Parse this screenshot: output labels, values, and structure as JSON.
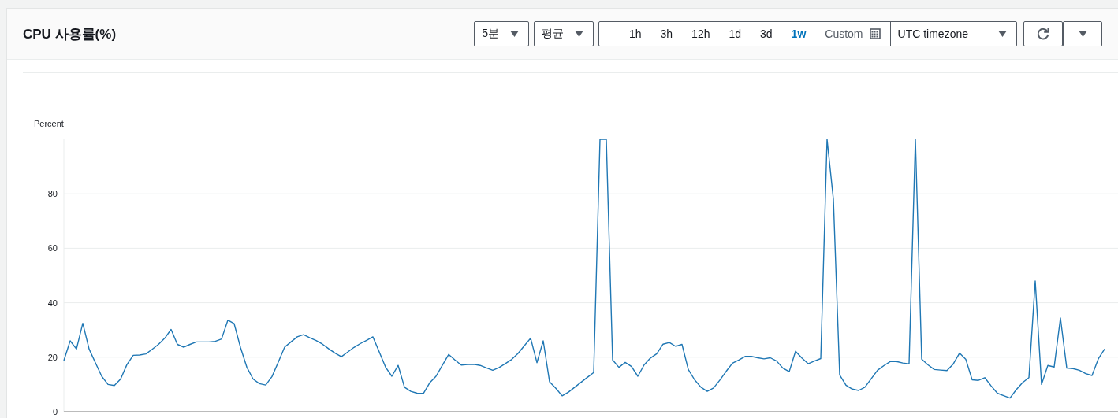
{
  "widget": {
    "title": "CPU 사용률(%)",
    "period": "5분",
    "statistic": "평균",
    "ranges": [
      {
        "label": "1h",
        "kind": "preset",
        "selected": false
      },
      {
        "label": "3h",
        "kind": "preset",
        "selected": false
      },
      {
        "label": "12h",
        "kind": "preset",
        "selected": false
      },
      {
        "label": "1d",
        "kind": "preset",
        "selected": false
      },
      {
        "label": "3d",
        "kind": "preset",
        "selected": false
      },
      {
        "label": "1w",
        "kind": "preset",
        "selected": true
      },
      {
        "label": "Custom",
        "kind": "custom",
        "selected": false
      }
    ],
    "timezone": "UTC timezone"
  },
  "chart_data": {
    "type": "line",
    "annotations": [
      {
        "text": "Percent"
      }
    ],
    "grid": true,
    "ylim": [
      0,
      100
    ],
    "yticks": [
      0,
      20,
      40,
      60,
      80
    ],
    "categories": [
      null,
      null,
      null,
      null,
      null,
      null,
      null,
      null,
      null,
      null,
      null,
      null,
      null,
      null,
      null,
      null,
      null,
      null,
      null,
      null,
      null,
      null,
      null,
      null,
      null,
      null,
      null,
      null,
      null,
      null,
      null,
      null,
      null,
      null,
      null,
      null,
      null,
      null,
      null,
      null,
      null,
      null,
      null,
      null,
      null,
      null,
      null,
      null,
      null,
      null,
      null,
      null,
      null,
      null,
      null,
      null,
      null,
      null,
      null,
      null,
      null,
      null,
      null,
      null,
      null,
      null,
      null,
      null,
      null,
      null,
      null,
      null,
      null,
      null,
      null,
      null,
      null,
      null,
      null,
      null,
      null,
      null,
      null,
      null,
      null,
      null,
      null,
      null,
      null,
      null,
      null,
      null,
      null,
      null,
      null,
      null,
      null,
      null,
      null,
      null,
      null,
      null,
      null,
      null,
      null,
      null,
      null,
      null,
      null,
      null,
      null,
      null,
      null,
      null,
      null,
      null,
      null,
      null,
      null,
      null,
      null,
      null,
      null,
      null,
      null,
      null,
      null,
      null,
      null,
      null,
      null,
      null,
      null,
      null,
      null,
      null,
      null,
      null,
      null,
      null,
      null,
      null,
      null,
      null,
      null,
      null,
      null,
      null,
      null,
      null,
      null,
      null,
      null,
      null,
      null,
      null,
      null,
      null,
      null,
      null,
      null,
      null,
      null,
      null,
      null,
      null
    ],
    "series": [
      {
        "color": "#1f77b4",
        "values": [
          18.8,
          26,
          23,
          32.5,
          23,
          18,
          13,
          10,
          9.6,
          12,
          17.3,
          20.7,
          20.8,
          21.2,
          22.9,
          24.7,
          27,
          30.2,
          24.7,
          23.7,
          24.7,
          25.6,
          25.6,
          25.6,
          25.8,
          26.7,
          33.6,
          32.3,
          23.6,
          16.4,
          12,
          10.3,
          9.8,
          12.9,
          18.2,
          23.7,
          25.6,
          27.5,
          28.3,
          27.1,
          26.1,
          24.8,
          23.1,
          21.5,
          20.2,
          21.9,
          23.6,
          25,
          26.2,
          27.5,
          22,
          16.4,
          13,
          17,
          9,
          7.5,
          6.8,
          6.7,
          10.6,
          13,
          17,
          21,
          19,
          17.1,
          17.3,
          17.4,
          17,
          16.1,
          15.2,
          16.2,
          17.7,
          19.2,
          21.4,
          24.2,
          27,
          18,
          26,
          11,
          8.6,
          5.8,
          7.2,
          9,
          10.8,
          12.6,
          14.4,
          100,
          100,
          19,
          16.3,
          18.1,
          16.6,
          13,
          17.2,
          19.7,
          21.3,
          24.8,
          25.4,
          24,
          24.7,
          15.5,
          11.7,
          9,
          7.5,
          8.7,
          11.6,
          14.8,
          17.8,
          19,
          20.3,
          20.3,
          19.8,
          19.4,
          19.8,
          18.6,
          16,
          14.7,
          22.2,
          19.7,
          17.6,
          18.6,
          19.5,
          100,
          78,
          13.5,
          9.7,
          8.3,
          7.8,
          9,
          12.1,
          15.2,
          16.9,
          18.4,
          18.4,
          17.9,
          17.6,
          100,
          19.3,
          17.2,
          15.5,
          15.3,
          15.1,
          17.5,
          21.5,
          19.2,
          11.7,
          11.5,
          12.5,
          9.5,
          6.8,
          5.9,
          5,
          8.1,
          10.7,
          12.5,
          48,
          10,
          17,
          16.4,
          34.4,
          16,
          15.8,
          15.2,
          14,
          13.3,
          19.4,
          23
        ]
      }
    ]
  }
}
